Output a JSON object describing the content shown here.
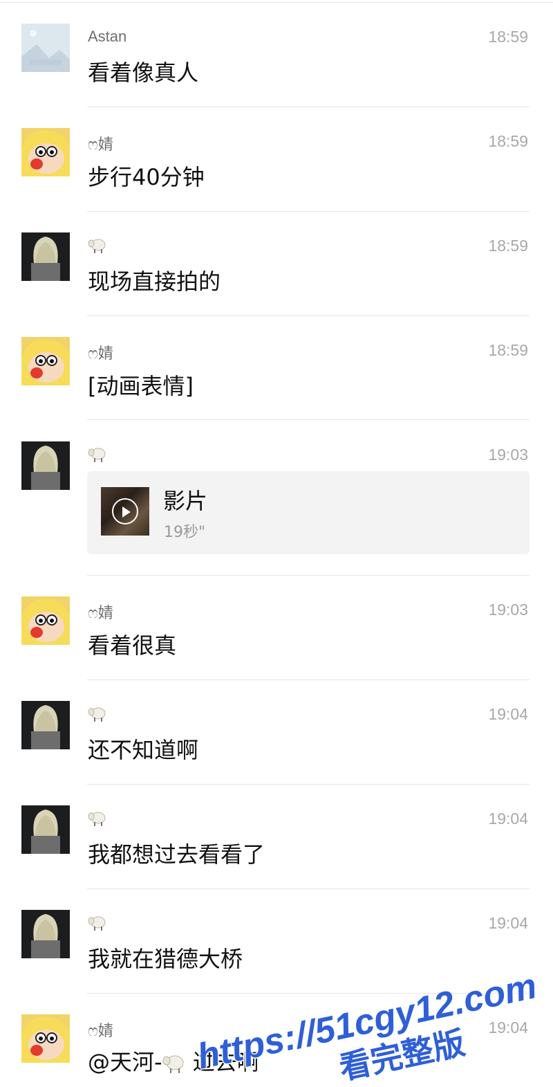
{
  "messages": [
    {
      "sender": "Astan",
      "time": "18:59",
      "text": "看着像真人",
      "avatar": "landscape-placeholder-avatar"
    },
    {
      "sender": "ෆ婧",
      "time": "18:59",
      "text": "步行40分钟",
      "avatar": "cartoon-boy-avatar"
    },
    {
      "sender": "sheep-emoji",
      "time": "18:59",
      "text": "现场直接拍的",
      "avatar": "blonde-person-avatar"
    },
    {
      "sender": "ෆ婧",
      "time": "18:59",
      "text": "[动画表情]",
      "avatar": "cartoon-boy-avatar"
    },
    {
      "sender": "sheep-emoji",
      "time": "19:03",
      "avatar": "blonde-person-avatar",
      "video": {
        "title": "影片",
        "duration": "19秒\""
      }
    },
    {
      "sender": "ෆ婧",
      "time": "19:03",
      "text": "看着很真",
      "avatar": "cartoon-boy-avatar"
    },
    {
      "sender": "sheep-emoji",
      "time": "19:04",
      "text": "还不知道啊",
      "avatar": "blonde-person-avatar"
    },
    {
      "sender": "sheep-emoji",
      "time": "19:04",
      "text": "我都想过去看看了",
      "avatar": "blonde-person-avatar"
    },
    {
      "sender": "sheep-emoji",
      "time": "19:04",
      "text": "我就在猎德大桥",
      "avatar": "blonde-person-avatar"
    },
    {
      "sender": "ෆ婧",
      "time": "19:04",
      "text_prefix": "@天河-",
      "text_suffix": " 过去啊",
      "avatar": "cartoon-boy-avatar"
    }
  ],
  "watermark": {
    "line1": "https://51cgy12.com",
    "line2": "看完整版",
    "color": "#2f5fd8"
  },
  "colors": {
    "divider": "#e4e4e4",
    "time": "#a8a8a8",
    "name": "#6f6f6f",
    "message_text": "#111111",
    "video_card_bg": "#f3f3f3"
  }
}
